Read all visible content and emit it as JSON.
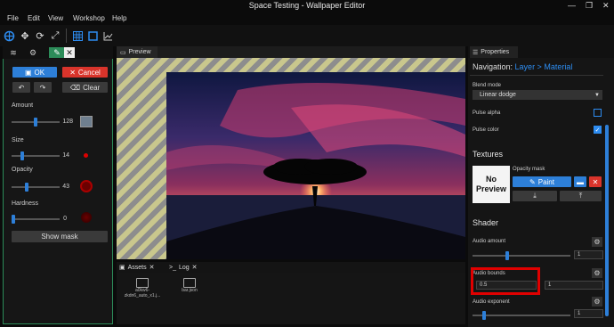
{
  "window": {
    "title": "Space Testing - Wallpaper Editor",
    "minimize": "—",
    "maximize": "❐",
    "close": "✕"
  },
  "menu": [
    "File",
    "Edit",
    "View",
    "Workshop",
    "Help"
  ],
  "toolbar": {
    "icons": [
      "crosshair-icon",
      "move-icon",
      "rotate-icon",
      "scale-icon",
      "grid-icon",
      "square-icon",
      "chart-icon"
    ]
  },
  "left_panel": {
    "ok_label": "OK",
    "cancel_label": "Cancel",
    "clear_label": "Clear",
    "amount": {
      "label": "Amount",
      "value": "128",
      "level": 0.5
    },
    "size": {
      "label": "Size",
      "value": "14",
      "level": 0.2
    },
    "opacity": {
      "label": "Opacity",
      "value": "43",
      "level": 0.3
    },
    "hardness": {
      "label": "Hardness",
      "value": "0",
      "level": 0.0
    },
    "show_mask_label": "Show mask"
  },
  "preview": {
    "tab_label": "Preview"
  },
  "assets": {
    "tabs": [
      "Assets",
      "Log"
    ],
    "items": [
      {
        "name": "a0kw6-zkdn6_auto_x1.j..."
      },
      {
        "name": "bar.json"
      }
    ]
  },
  "properties": {
    "tab_label": "Properties",
    "nav_prefix": "Navigation:",
    "nav_path": "Layer > Material",
    "blend_mode_label": "Blend mode",
    "blend_mode_value": "Linear dodge",
    "pulse_alpha_label": "Pulse alpha",
    "pulse_alpha_checked": false,
    "pulse_color_label": "Pulse color",
    "pulse_color_checked": true,
    "textures_title": "Textures",
    "no_preview_label": "No Preview",
    "opacity_mask_label": "Opacity mask",
    "paint_label": "Paint",
    "shader_title": "Shader",
    "audio_amount": {
      "label": "Audio amount",
      "value": "1",
      "level": 0.35
    },
    "audio_bounds": {
      "label": "Audio bounds",
      "min": "0.5",
      "max": "1"
    },
    "audio_exponent": {
      "label": "Audio exponent",
      "value": "1",
      "level": 0.1
    }
  },
  "colors": {
    "accent": "#2d8cf0",
    "cancel": "#d9342b",
    "panel_border": "#2c8c59",
    "highlight": "#e00000"
  }
}
